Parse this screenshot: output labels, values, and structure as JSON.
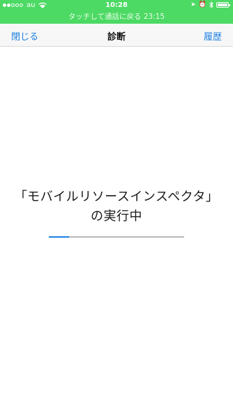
{
  "status_bar": {
    "carrier": "au",
    "time": "10:28",
    "signal_bars_filled": 2,
    "signal_bars_total": 5,
    "battery_level": 1.0,
    "background_color": "#4cd964",
    "icons": [
      "location-arrow-icon",
      "alarm-icon",
      "bluetooth-icon",
      "battery-icon"
    ]
  },
  "call_banner": {
    "text": "タッチして通話に戻る 23:15"
  },
  "nav": {
    "close_label": "閉じる",
    "title": "診断",
    "history_label": "履歴",
    "accent_color": "#1b7fe3"
  },
  "main": {
    "message": "「モバイルリソースインスペクタ」の実行中",
    "progress": 0.15
  }
}
